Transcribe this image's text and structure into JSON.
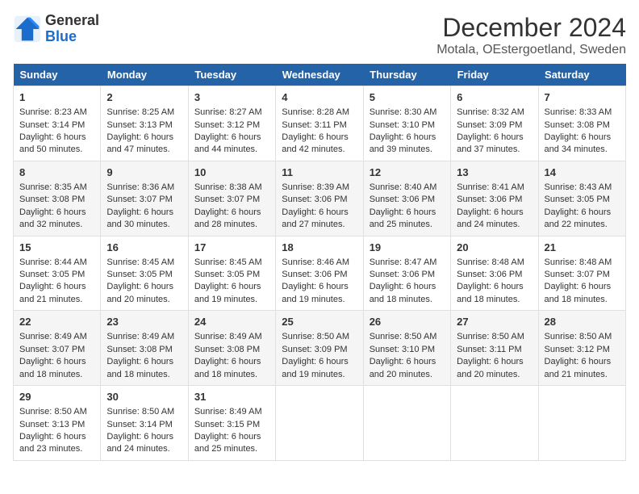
{
  "header": {
    "logo_general": "General",
    "logo_blue": "Blue",
    "title": "December 2024",
    "subtitle": "Motala, OEstergoetland, Sweden"
  },
  "days_of_week": [
    "Sunday",
    "Monday",
    "Tuesday",
    "Wednesday",
    "Thursday",
    "Friday",
    "Saturday"
  ],
  "weeks": [
    [
      {
        "day": "1",
        "sunrise": "Sunrise: 8:23 AM",
        "sunset": "Sunset: 3:14 PM",
        "daylight": "Daylight: 6 hours and 50 minutes."
      },
      {
        "day": "2",
        "sunrise": "Sunrise: 8:25 AM",
        "sunset": "Sunset: 3:13 PM",
        "daylight": "Daylight: 6 hours and 47 minutes."
      },
      {
        "day": "3",
        "sunrise": "Sunrise: 8:27 AM",
        "sunset": "Sunset: 3:12 PM",
        "daylight": "Daylight: 6 hours and 44 minutes."
      },
      {
        "day": "4",
        "sunrise": "Sunrise: 8:28 AM",
        "sunset": "Sunset: 3:11 PM",
        "daylight": "Daylight: 6 hours and 42 minutes."
      },
      {
        "day": "5",
        "sunrise": "Sunrise: 8:30 AM",
        "sunset": "Sunset: 3:10 PM",
        "daylight": "Daylight: 6 hours and 39 minutes."
      },
      {
        "day": "6",
        "sunrise": "Sunrise: 8:32 AM",
        "sunset": "Sunset: 3:09 PM",
        "daylight": "Daylight: 6 hours and 37 minutes."
      },
      {
        "day": "7",
        "sunrise": "Sunrise: 8:33 AM",
        "sunset": "Sunset: 3:08 PM",
        "daylight": "Daylight: 6 hours and 34 minutes."
      }
    ],
    [
      {
        "day": "8",
        "sunrise": "Sunrise: 8:35 AM",
        "sunset": "Sunset: 3:08 PM",
        "daylight": "Daylight: 6 hours and 32 minutes."
      },
      {
        "day": "9",
        "sunrise": "Sunrise: 8:36 AM",
        "sunset": "Sunset: 3:07 PM",
        "daylight": "Daylight: 6 hours and 30 minutes."
      },
      {
        "day": "10",
        "sunrise": "Sunrise: 8:38 AM",
        "sunset": "Sunset: 3:07 PM",
        "daylight": "Daylight: 6 hours and 28 minutes."
      },
      {
        "day": "11",
        "sunrise": "Sunrise: 8:39 AM",
        "sunset": "Sunset: 3:06 PM",
        "daylight": "Daylight: 6 hours and 27 minutes."
      },
      {
        "day": "12",
        "sunrise": "Sunrise: 8:40 AM",
        "sunset": "Sunset: 3:06 PM",
        "daylight": "Daylight: 6 hours and 25 minutes."
      },
      {
        "day": "13",
        "sunrise": "Sunrise: 8:41 AM",
        "sunset": "Sunset: 3:06 PM",
        "daylight": "Daylight: 6 hours and 24 minutes."
      },
      {
        "day": "14",
        "sunrise": "Sunrise: 8:43 AM",
        "sunset": "Sunset: 3:05 PM",
        "daylight": "Daylight: 6 hours and 22 minutes."
      }
    ],
    [
      {
        "day": "15",
        "sunrise": "Sunrise: 8:44 AM",
        "sunset": "Sunset: 3:05 PM",
        "daylight": "Daylight: 6 hours and 21 minutes."
      },
      {
        "day": "16",
        "sunrise": "Sunrise: 8:45 AM",
        "sunset": "Sunset: 3:05 PM",
        "daylight": "Daylight: 6 hours and 20 minutes."
      },
      {
        "day": "17",
        "sunrise": "Sunrise: 8:45 AM",
        "sunset": "Sunset: 3:05 PM",
        "daylight": "Daylight: 6 hours and 19 minutes."
      },
      {
        "day": "18",
        "sunrise": "Sunrise: 8:46 AM",
        "sunset": "Sunset: 3:06 PM",
        "daylight": "Daylight: 6 hours and 19 minutes."
      },
      {
        "day": "19",
        "sunrise": "Sunrise: 8:47 AM",
        "sunset": "Sunset: 3:06 PM",
        "daylight": "Daylight: 6 hours and 18 minutes."
      },
      {
        "day": "20",
        "sunrise": "Sunrise: 8:48 AM",
        "sunset": "Sunset: 3:06 PM",
        "daylight": "Daylight: 6 hours and 18 minutes."
      },
      {
        "day": "21",
        "sunrise": "Sunrise: 8:48 AM",
        "sunset": "Sunset: 3:07 PM",
        "daylight": "Daylight: 6 hours and 18 minutes."
      }
    ],
    [
      {
        "day": "22",
        "sunrise": "Sunrise: 8:49 AM",
        "sunset": "Sunset: 3:07 PM",
        "daylight": "Daylight: 6 hours and 18 minutes."
      },
      {
        "day": "23",
        "sunrise": "Sunrise: 8:49 AM",
        "sunset": "Sunset: 3:08 PM",
        "daylight": "Daylight: 6 hours and 18 minutes."
      },
      {
        "day": "24",
        "sunrise": "Sunrise: 8:49 AM",
        "sunset": "Sunset: 3:08 PM",
        "daylight": "Daylight: 6 hours and 18 minutes."
      },
      {
        "day": "25",
        "sunrise": "Sunrise: 8:50 AM",
        "sunset": "Sunset: 3:09 PM",
        "daylight": "Daylight: 6 hours and 19 minutes."
      },
      {
        "day": "26",
        "sunrise": "Sunrise: 8:50 AM",
        "sunset": "Sunset: 3:10 PM",
        "daylight": "Daylight: 6 hours and 20 minutes."
      },
      {
        "day": "27",
        "sunrise": "Sunrise: 8:50 AM",
        "sunset": "Sunset: 3:11 PM",
        "daylight": "Daylight: 6 hours and 20 minutes."
      },
      {
        "day": "28",
        "sunrise": "Sunrise: 8:50 AM",
        "sunset": "Sunset: 3:12 PM",
        "daylight": "Daylight: 6 hours and 21 minutes."
      }
    ],
    [
      {
        "day": "29",
        "sunrise": "Sunrise: 8:50 AM",
        "sunset": "Sunset: 3:13 PM",
        "daylight": "Daylight: 6 hours and 23 minutes."
      },
      {
        "day": "30",
        "sunrise": "Sunrise: 8:50 AM",
        "sunset": "Sunset: 3:14 PM",
        "daylight": "Daylight: 6 hours and 24 minutes."
      },
      {
        "day": "31",
        "sunrise": "Sunrise: 8:49 AM",
        "sunset": "Sunset: 3:15 PM",
        "daylight": "Daylight: 6 hours and 25 minutes."
      },
      null,
      null,
      null,
      null
    ]
  ]
}
